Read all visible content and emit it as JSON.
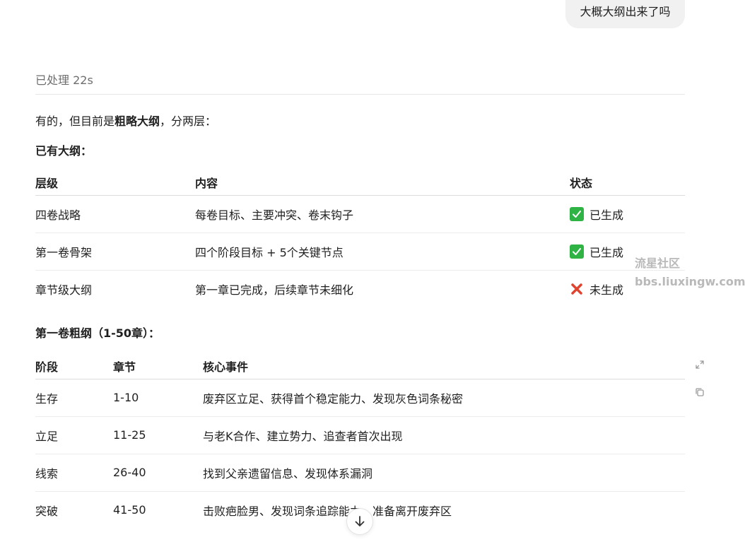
{
  "user_message": "大概大纲出来了吗",
  "processed_label": "已处理 22s",
  "intro": {
    "prefix": "有的，但目前是",
    "bold": "粗略大纲",
    "suffix": "，分两层："
  },
  "outline_heading": "已有大纲：",
  "outline_table": {
    "headers": [
      "层级",
      "内容",
      "状态"
    ],
    "rows": [
      {
        "level": "四卷战略",
        "content": "每卷目标、主要冲突、卷末钩子",
        "status": "已生成",
        "status_icon": "check-box-icon"
      },
      {
        "level": "第一卷骨架",
        "content": "四个阶段目标 + 5个关键节点",
        "status": "已生成",
        "status_icon": "check-box-icon"
      },
      {
        "level": "章节级大纲",
        "content": "第一章已完成，后续章节未细化",
        "status": "未生成",
        "status_icon": "cross-mark-icon"
      }
    ]
  },
  "volume1_heading": "第一卷粗纲（1-50章）：",
  "volume1_table": {
    "headers": [
      "阶段",
      "章节",
      "核心事件"
    ],
    "rows": [
      {
        "stage": "生存",
        "chapters": "1-10",
        "event": "废弃区立足、获得首个稳定能力、发现灰色词条秘密"
      },
      {
        "stage": "立足",
        "chapters": "11-25",
        "event": "与老K合作、建立势力、追查者首次出现"
      },
      {
        "stage": "线索",
        "chapters": "26-40",
        "event": "找到父亲遗留信息、发现体系漏洞"
      },
      {
        "stage": "突破",
        "chapters": "41-50",
        "event": "击败疤脸男、发现词条追踪能力、准备离开废弃区"
      }
    ]
  },
  "watermark": {
    "line1": "流星社区",
    "line2": "bbs.liuxingw.com"
  },
  "colors": {
    "check_green": "#2fb344",
    "cross_red": "#e0442e"
  }
}
